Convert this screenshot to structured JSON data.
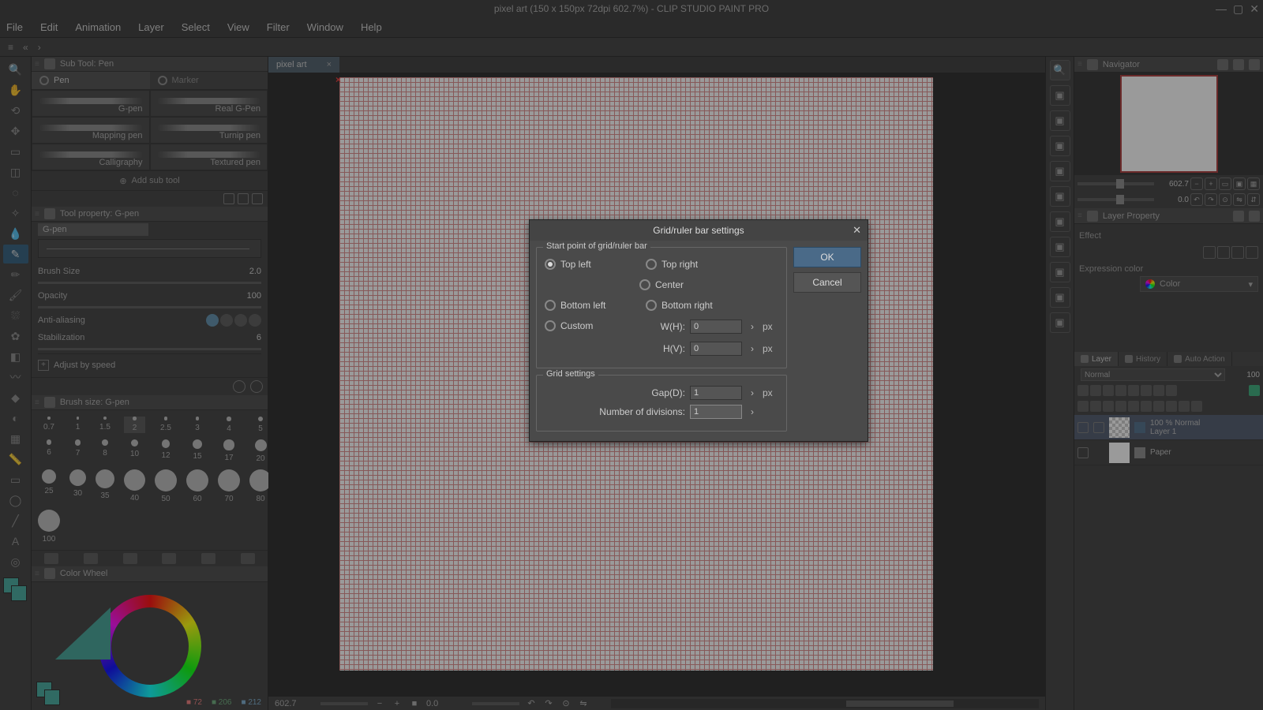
{
  "titlebar": "pixel art (150 x 150px 72dpi 602.7%)  - CLIP STUDIO PAINT PRO",
  "menu": [
    "File",
    "Edit",
    "Animation",
    "Layer",
    "Select",
    "View",
    "Filter",
    "Window",
    "Help"
  ],
  "subtool": {
    "panel_title": "Sub Tool: Pen",
    "tabs": {
      "pen": "Pen",
      "marker": "Marker"
    },
    "items": [
      "G-pen",
      "Real G-Pen",
      "Mapping pen",
      "Turnip pen",
      "Calligraphy",
      "Textured pen"
    ],
    "add": "Add sub tool"
  },
  "toolprop": {
    "panel_title": "Tool property: G-pen",
    "name": "G-pen",
    "brush_size_label": "Brush Size",
    "brush_size_val": "2.0",
    "opacity_label": "Opacity",
    "opacity_val": "100",
    "aa_label": "Anti-aliasing",
    "stab_label": "Stabilization",
    "stab_val": "6",
    "adjust": "Adjust by speed"
  },
  "brushsize": {
    "panel_title": "Brush size: G-pen",
    "sizes": [
      0.7,
      1,
      1.5,
      2,
      2.5,
      3,
      4,
      5,
      6,
      7,
      8,
      10,
      12,
      15,
      17,
      20,
      25,
      30,
      35,
      40,
      50,
      60,
      70,
      80,
      100
    ]
  },
  "colorwheel": {
    "panel_title": "Color Wheel",
    "r": 72,
    "g": 206,
    "b": 212
  },
  "doc_tab": "pixel art",
  "status": {
    "zoom": "602.7",
    "angle": "0.0"
  },
  "navigator": {
    "panel_title": "Navigator",
    "zoom": "602.7",
    "angle": "0.0"
  },
  "layerprop": {
    "panel_title": "Layer Property",
    "effect": "Effect",
    "exp_label": "Expression color",
    "exp_val": "Color"
  },
  "layerpanel": {
    "tabs": {
      "layer": "Layer",
      "history": "History",
      "auto": "Auto Action"
    },
    "blend": "Normal",
    "opacity": "100",
    "layers": [
      {
        "mode": "100 % Normal",
        "name": "Layer 1"
      },
      {
        "mode": "",
        "name": "Paper"
      }
    ]
  },
  "dialog": {
    "title": "Grid/ruler bar settings",
    "fs1": "Start point of grid/ruler bar",
    "r_tl": "Top left",
    "r_tr": "Top right",
    "r_c": "Center",
    "r_bl": "Bottom left",
    "r_br": "Bottom right",
    "r_cu": "Custom",
    "wh": "W(H):",
    "hv": "H(V):",
    "px": "px",
    "wh_val": "0",
    "hv_val": "0",
    "fs2": "Grid settings",
    "gap": "Gap(D):",
    "gap_val": "1",
    "div": "Number of divisions:",
    "div_val": "1",
    "ok": "OK",
    "cancel": "Cancel"
  }
}
